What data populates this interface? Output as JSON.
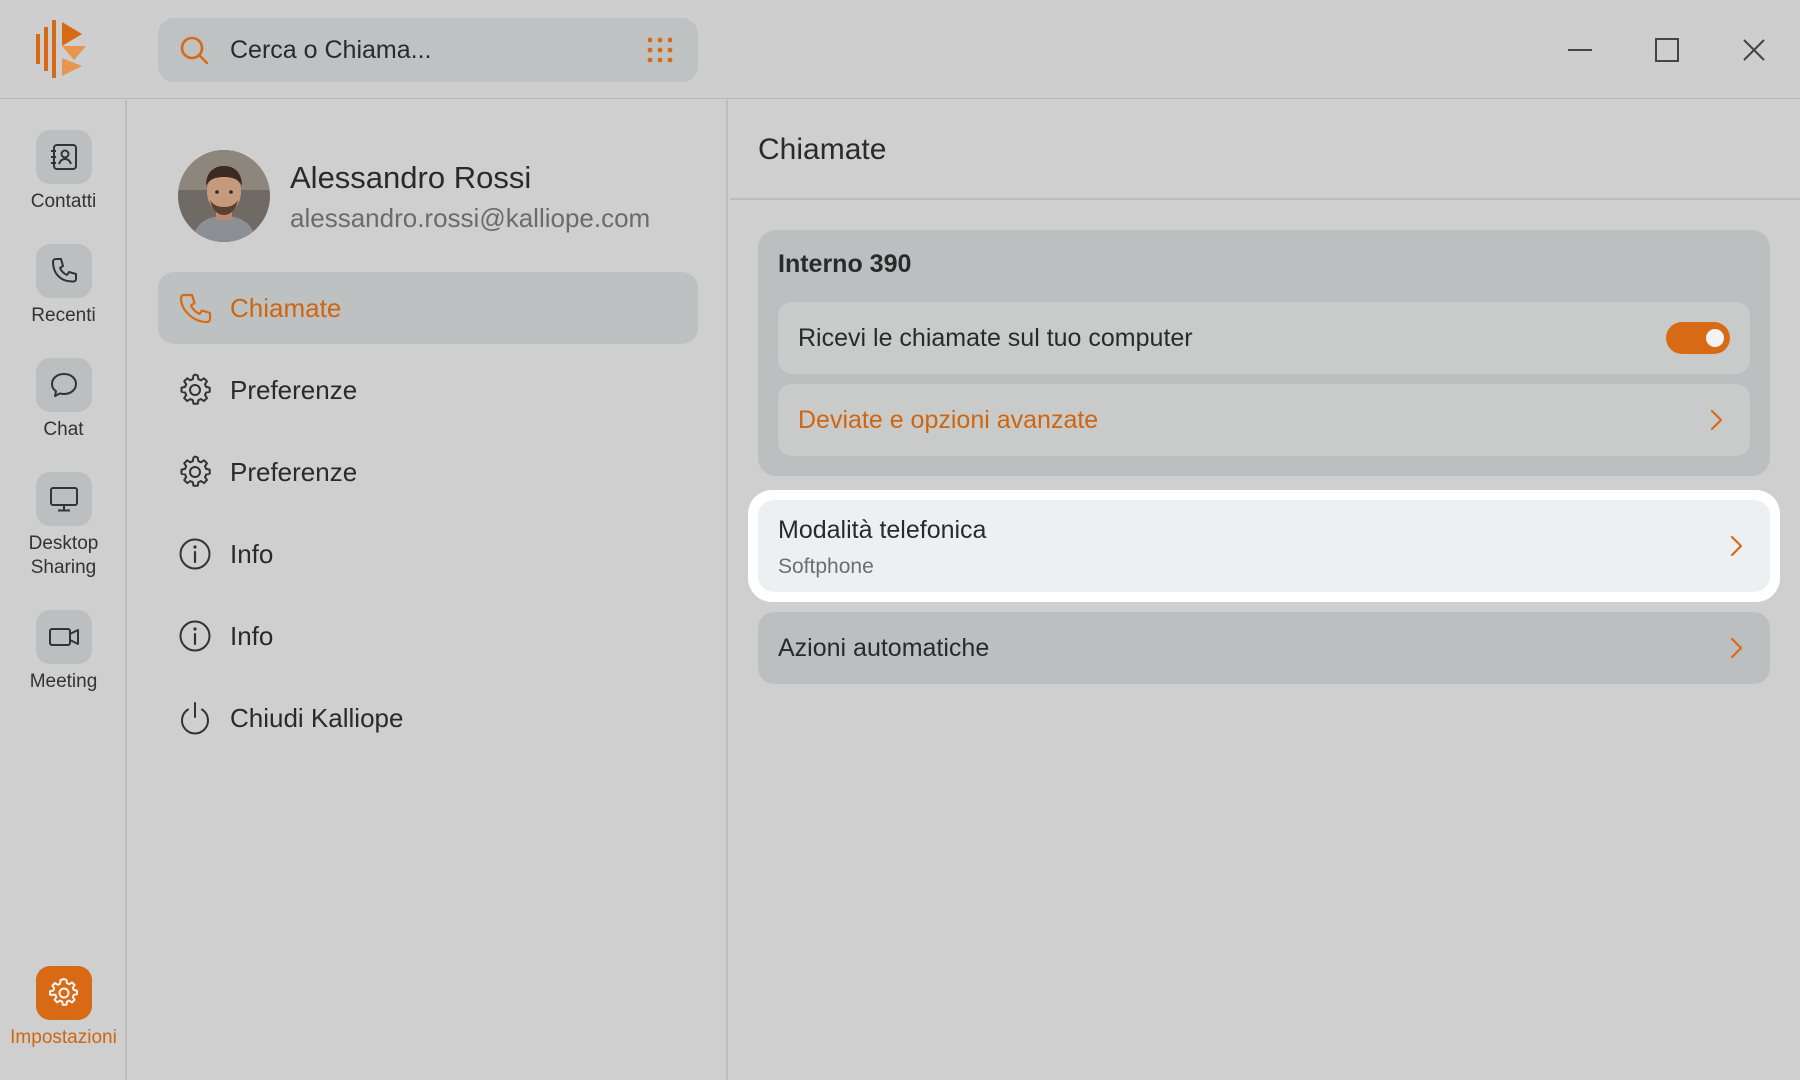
{
  "window": {
    "minimize_icon": "minimize-icon",
    "maximize_icon": "maximize-icon",
    "close_icon": "close-icon"
  },
  "search": {
    "placeholder": "Cerca o Chiama...",
    "icon": "search-icon",
    "dialpad_icon": "dialpad-icon"
  },
  "rail": {
    "items": [
      {
        "label": "Contatti",
        "icon": "contacts-icon"
      },
      {
        "label": "Recenti",
        "icon": "phone-icon"
      },
      {
        "label": "Chat",
        "icon": "chat-bubble-icon"
      },
      {
        "label": "Desktop Sharing",
        "icon": "monitor-icon"
      },
      {
        "label": "Meeting",
        "icon": "video-camera-icon"
      },
      {
        "label": "Impostazioni",
        "icon": "gear-icon",
        "active": true
      }
    ]
  },
  "profile": {
    "name": "Alessandro Rossi",
    "email": "alessandro.rossi@kalliope.com"
  },
  "menu": {
    "items": [
      {
        "label": "Chiamate",
        "icon": "phone-icon",
        "active": true
      },
      {
        "label": "Preferenze",
        "icon": "gear-icon"
      },
      {
        "label": "Preferenze",
        "icon": "gear-icon"
      },
      {
        "label": "Info",
        "icon": "info-icon"
      },
      {
        "label": "Info",
        "icon": "info-icon"
      },
      {
        "label": "Chiudi Kalliope",
        "icon": "power-icon"
      }
    ]
  },
  "content": {
    "title": "Chiamate",
    "extension_group": {
      "title": "Interno 390",
      "receive_calls": {
        "label": "Ricevi le chiamate sul tuo computer",
        "enabled": true
      },
      "forward": {
        "label": "Deviate e opzioni avanzate"
      }
    },
    "phone_mode": {
      "title": "Modalità telefonica",
      "value": "Softphone"
    },
    "auto_actions": {
      "label": "Azioni automatiche"
    }
  },
  "colors": {
    "accent": "#d96a15",
    "background": "#cfcfcf",
    "panel": "#bcbfbf",
    "highlight_card": "#edf0f2"
  }
}
